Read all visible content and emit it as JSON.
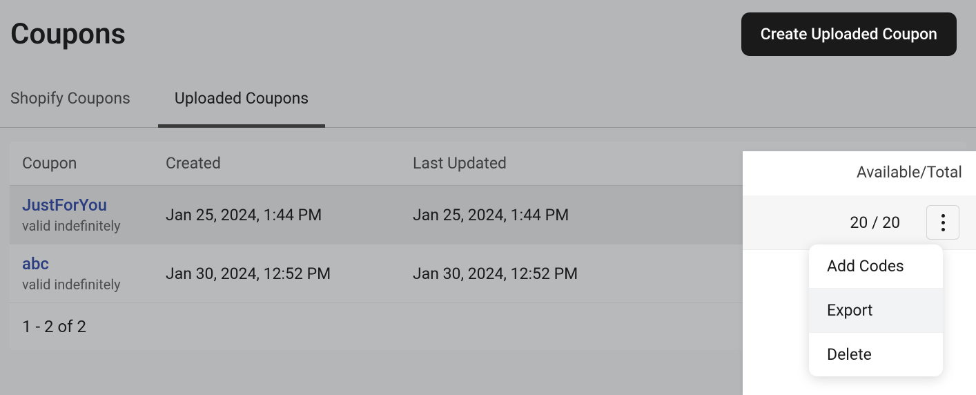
{
  "header": {
    "title": "Coupons",
    "create_button": "Create Uploaded Coupon"
  },
  "tabs": [
    {
      "label": "Shopify Coupons",
      "active": false
    },
    {
      "label": "Uploaded Coupons",
      "active": true
    }
  ],
  "table": {
    "columns": {
      "coupon": "Coupon",
      "created": "Created",
      "updated": "Last Updated",
      "available": "Available/Total"
    },
    "rows": [
      {
        "name": "JustForYou",
        "validity": "valid indefinitely",
        "created": "Jan 25, 2024, 1:44 PM",
        "updated": "Jan 25, 2024, 1:44 PM",
        "available_total": "20 / 20"
      },
      {
        "name": "abc",
        "validity": "valid indefinitely",
        "created": "Jan 30, 2024, 12:52 PM",
        "updated": "Jan 30, 2024, 12:52 PM",
        "available_total": ""
      }
    ],
    "pagination": "1 - 2 of 2"
  },
  "menu": {
    "items": [
      {
        "label": "Add Codes",
        "hover": false
      },
      {
        "label": "Export",
        "hover": true
      },
      {
        "label": "Delete",
        "hover": false
      }
    ]
  }
}
